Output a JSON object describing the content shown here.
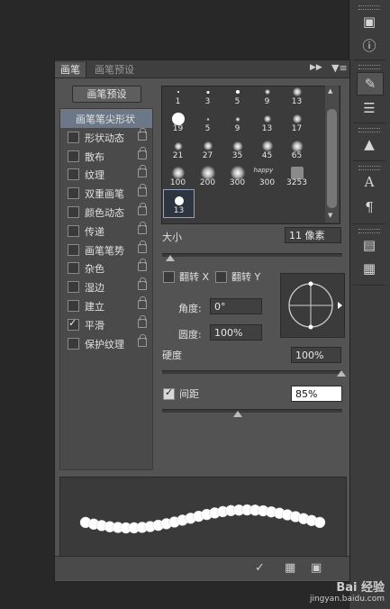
{
  "tabs": [
    {
      "label": "画笔"
    },
    {
      "label": "画笔预设"
    }
  ],
  "preset_button": "画笔预设",
  "options": [
    {
      "label": "画笔笔尖形状",
      "selected": true
    },
    {
      "label": "形状动态",
      "checked": false
    },
    {
      "label": "散布",
      "checked": false
    },
    {
      "label": "纹理",
      "checked": false
    },
    {
      "label": "双重画笔",
      "checked": false
    },
    {
      "label": "颜色动态",
      "checked": false
    },
    {
      "label": "传递",
      "checked": false
    },
    {
      "label": "画笔笔势",
      "checked": false
    },
    {
      "label": "杂色",
      "checked": false
    },
    {
      "label": "湿边",
      "checked": false
    },
    {
      "label": "建立",
      "checked": false
    },
    {
      "label": "平滑",
      "checked": true
    },
    {
      "label": "保护纹理",
      "checked": false
    }
  ],
  "brushes": [
    {
      "size": "1"
    },
    {
      "size": "3"
    },
    {
      "size": "5"
    },
    {
      "size": "9"
    },
    {
      "size": "13"
    },
    {
      "size": "19"
    },
    {
      "size": "5"
    },
    {
      "size": "9"
    },
    {
      "size": "13"
    },
    {
      "size": "17"
    },
    {
      "size": "21"
    },
    {
      "size": "27"
    },
    {
      "size": "35"
    },
    {
      "size": "45"
    },
    {
      "size": "65"
    },
    {
      "size": "100"
    },
    {
      "size": "200"
    },
    {
      "size": "300"
    },
    {
      "size": "300"
    },
    {
      "size": "3253"
    },
    {
      "size": "13"
    }
  ],
  "size_label": "大小",
  "size_value": "11 像素",
  "flip_x_label": "翻转 X",
  "flip_y_label": "翻转 Y",
  "angle_label": "角度:",
  "angle_value": "0°",
  "roundness_label": "圆度:",
  "roundness_value": "100%",
  "hardness_label": "硬度",
  "hardness_value": "100%",
  "spacing_label": "间距",
  "spacing_value": "85%",
  "spacing_checked": true,
  "watermark_line1": "Bai 经验",
  "watermark_line2": "jingyan.baidu.com"
}
